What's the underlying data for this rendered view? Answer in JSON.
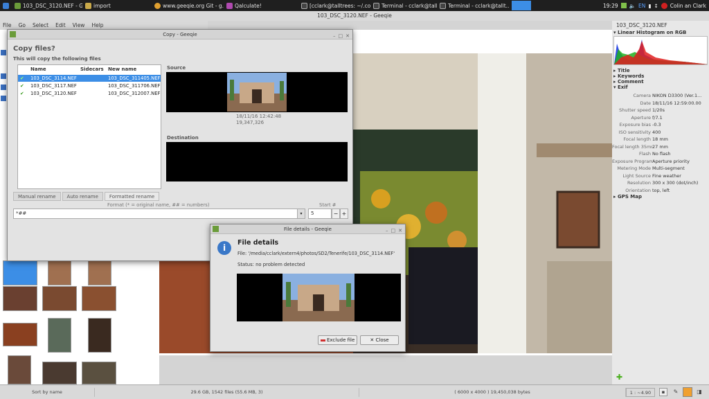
{
  "taskbar": {
    "items": [
      {
        "label": "103_DSC_3120.NEF - G..."
      },
      {
        "label": "import"
      },
      {
        "label": "www.geeqie.org Git - g..."
      },
      {
        "label": "Qalculate!"
      },
      {
        "label": "[cclark@talltrees: ~/.co..."
      },
      {
        "label": "Terminal - cclark@tallt..."
      },
      {
        "label": "Terminal - cclark@tallt..."
      }
    ],
    "clock": "19:29",
    "keyboard": "EN",
    "user": "Colin an Clark"
  },
  "main": {
    "title": "103_DSC_3120.NEF - Geeqie",
    "menu": [
      "File",
      "Go",
      "Select",
      "Edit",
      "View",
      "Help"
    ]
  },
  "sidebar": {
    "filename": "103_DSC_3120.NEF",
    "histogram_title": "Linear Histogram on RGB",
    "sections": [
      "Title",
      "Keywords",
      "Comment",
      "Exif"
    ],
    "exif": [
      {
        "k": "Camera",
        "v": "NIKON D3300 (Ver.1..."
      },
      {
        "k": "Date",
        "v": "18/11/16 12:59:00.00"
      },
      {
        "k": "Shutter speed",
        "v": "1/20s"
      },
      {
        "k": "Aperture",
        "v": "f/7.1"
      },
      {
        "k": "Exposure bias",
        "v": "-0.3"
      },
      {
        "k": "ISO sensitivity",
        "v": "400"
      },
      {
        "k": "Focal length",
        "v": "18 mm"
      },
      {
        "k": "Focal length 35mm",
        "v": "27 mm"
      },
      {
        "k": "Flash",
        "v": "No flash"
      },
      {
        "k": "Exposure Program",
        "v": "Aperture priority"
      },
      {
        "k": "Metering Mode",
        "v": "Multi-segment"
      },
      {
        "k": "Light Source",
        "v": "Fine weather"
      },
      {
        "k": "Resolution",
        "v": "300 x 300 (dot/inch)"
      },
      {
        "k": "Orientation",
        "v": "top, left"
      }
    ],
    "gps": "GPS Map"
  },
  "status": {
    "sort": "Sort by name",
    "disk": "29.6 GB, 1542 files (55.6 MB, 3)",
    "size": "( 6000 x 4000 ) 19,450,038 bytes",
    "zoom": "1 : ~4.90"
  },
  "copy_dialog": {
    "title": "Copy - Geeqie",
    "heading": "Copy files?",
    "subheading": "This will copy the following files",
    "columns": {
      "name": "Name",
      "sidecars": "Sidecars",
      "new": "New name"
    },
    "files": [
      {
        "name": "103_DSC_3114.NEF",
        "new": "103_DSC_311405.NEF"
      },
      {
        "name": "103_DSC_3117.NEF",
        "new": "103_DSC_311706.NEF"
      },
      {
        "name": "103_DSC_3120.NEF",
        "new": "103_DSC_312007.NEF"
      }
    ],
    "source_label": "Source",
    "source_date": "18/11/16 12:42:48",
    "source_size": "19,347,326",
    "dest_label": "Destination",
    "tabs": [
      "Manual rename",
      "Auto rename",
      "Formatted rename"
    ],
    "format_hint": "Format (* = original name, ## = numbers)",
    "start_label": "Start #",
    "format_value": "*##",
    "start_value": "5"
  },
  "detail_dialog": {
    "title": "File details - Geeqie",
    "heading": "File details",
    "file": "File: '/media/cclark/extern4/photos/SD2/Tenerife/103_DSC_3114.NEF'",
    "status": "Status: no problem detected",
    "exclude": "Exclude file",
    "close": "Close"
  }
}
